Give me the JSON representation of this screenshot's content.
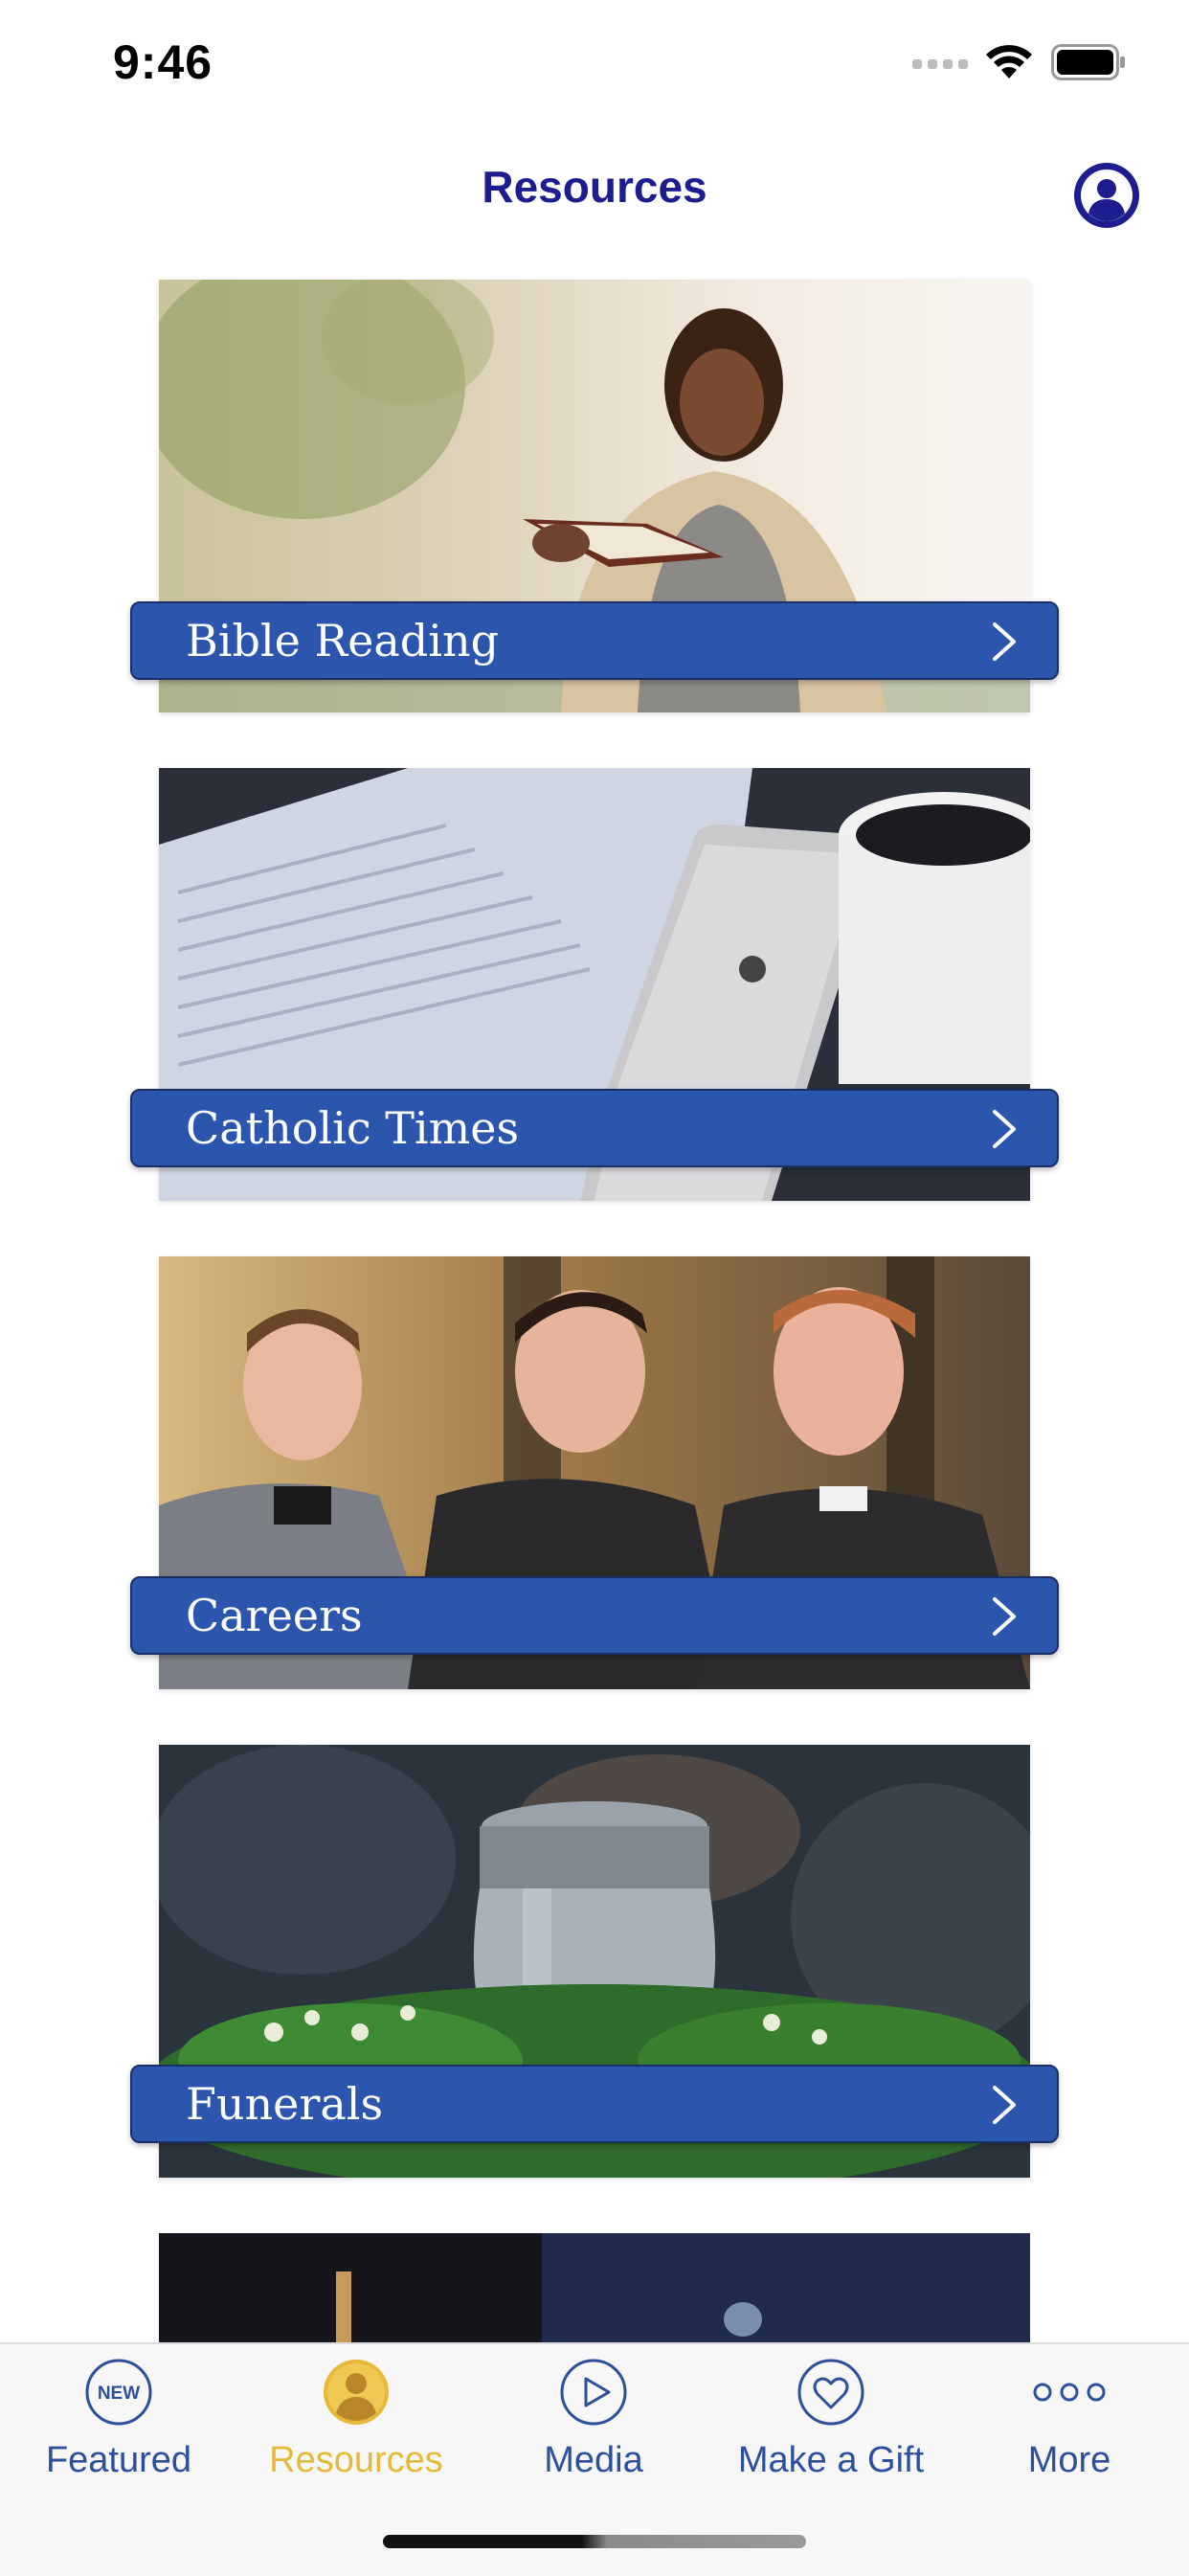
{
  "status_bar": {
    "time": "9:46"
  },
  "header": {
    "title": "Resources"
  },
  "cards": [
    {
      "label": "Bible Reading"
    },
    {
      "label": "Catholic Times"
    },
    {
      "label": "Careers"
    },
    {
      "label": "Funerals"
    }
  ],
  "tab_bar": {
    "items": [
      {
        "label": "Featured",
        "icon": "new-badge-icon",
        "badge": "NEW"
      },
      {
        "label": "Resources",
        "icon": "person-icon"
      },
      {
        "label": "Media",
        "icon": "play-icon"
      },
      {
        "label": "Make a Gift",
        "icon": "heart-icon"
      },
      {
        "label": "More",
        "icon": "more-dots-icon"
      }
    ],
    "active_index": 1
  },
  "colors": {
    "title": "#1d1d8f",
    "banner": "#2c55ad",
    "tab_inactive": "#2c4f9e",
    "tab_active": "#e6b93a"
  }
}
